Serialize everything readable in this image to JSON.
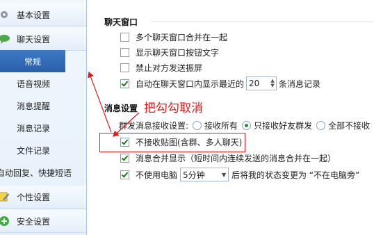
{
  "sidebar": {
    "categories": [
      {
        "label": "基本设置",
        "icon": "gear-icon"
      },
      {
        "label": "聊天设置",
        "icon": "chat-bubble-icon"
      },
      {
        "label": "个性设置",
        "icon": "pencil-icon"
      },
      {
        "label": "安全设置",
        "icon": "shield-plus-icon"
      }
    ],
    "items": [
      {
        "label": "常规",
        "selected": true
      },
      {
        "label": "语音视频"
      },
      {
        "label": "消息提醒"
      },
      {
        "label": "消息记录"
      },
      {
        "label": "文件记录"
      },
      {
        "label": "自动回复、快捷短语"
      }
    ]
  },
  "chat_window": {
    "title": "聊天窗口",
    "options": [
      {
        "label": "多个聊天窗口合并在一起",
        "checked": false
      },
      {
        "label": "显示聊天窗口按钮文字",
        "checked": false
      },
      {
        "label": "禁止对方发送振屏",
        "checked": false
      },
      {
        "label_before": "自动在聊天窗口内显示最近的",
        "value": "20",
        "label_after": "条消息记录",
        "checked": true
      }
    ]
  },
  "message_settings": {
    "title": "消息设置",
    "group_label": "群发消息接收设置:",
    "radios": [
      {
        "label": "接收所有",
        "selected": false
      },
      {
        "label": "只接收好友群发",
        "selected": true
      },
      {
        "label": "全部不接收",
        "selected": false
      }
    ],
    "no_images": {
      "label": "不接收贴图(含群、多人聊天)",
      "checked": true
    },
    "merge_display": {
      "label": "消息合并显示（短时间内连续发送的消息合并在一起）",
      "checked": true
    },
    "idle": {
      "label_before": "不使用电脑",
      "value": "5分钟",
      "label_after": "后将我的状态变更为 “不在电脑旁”",
      "checked": true
    }
  },
  "annotation": {
    "text": "把勾勾取消",
    "color": "#e21b1b"
  },
  "colors": {
    "accent": "#2a5fa9",
    "annotation": "#e21b1b"
  }
}
